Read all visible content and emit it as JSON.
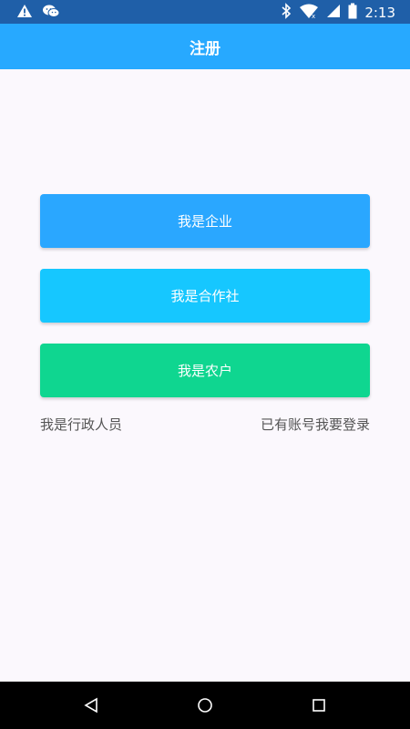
{
  "status_bar": {
    "time": "2:13",
    "icons": [
      "warning-icon",
      "wechat-icon",
      "bluetooth-icon",
      "wifi-icon",
      "signal-icon",
      "battery-icon"
    ]
  },
  "app_bar": {
    "title": "注册"
  },
  "buttons": {
    "enterprise": "我是企业",
    "cooperative": "我是合作社",
    "farmer": "我是农户"
  },
  "links": {
    "admin": "我是行政人员",
    "login": "已有账号我要登录"
  },
  "colors": {
    "status_bar": "#1f5fa8",
    "app_bar": "#27a9ff",
    "enterprise_button": "#2aa7ff",
    "cooperative_button": "#16c7ff",
    "farmer_button": "#0fd690",
    "background": "#fbf8fd"
  },
  "nav_bar": {
    "icons": [
      "back-icon",
      "home-icon",
      "recent-apps-icon"
    ]
  }
}
